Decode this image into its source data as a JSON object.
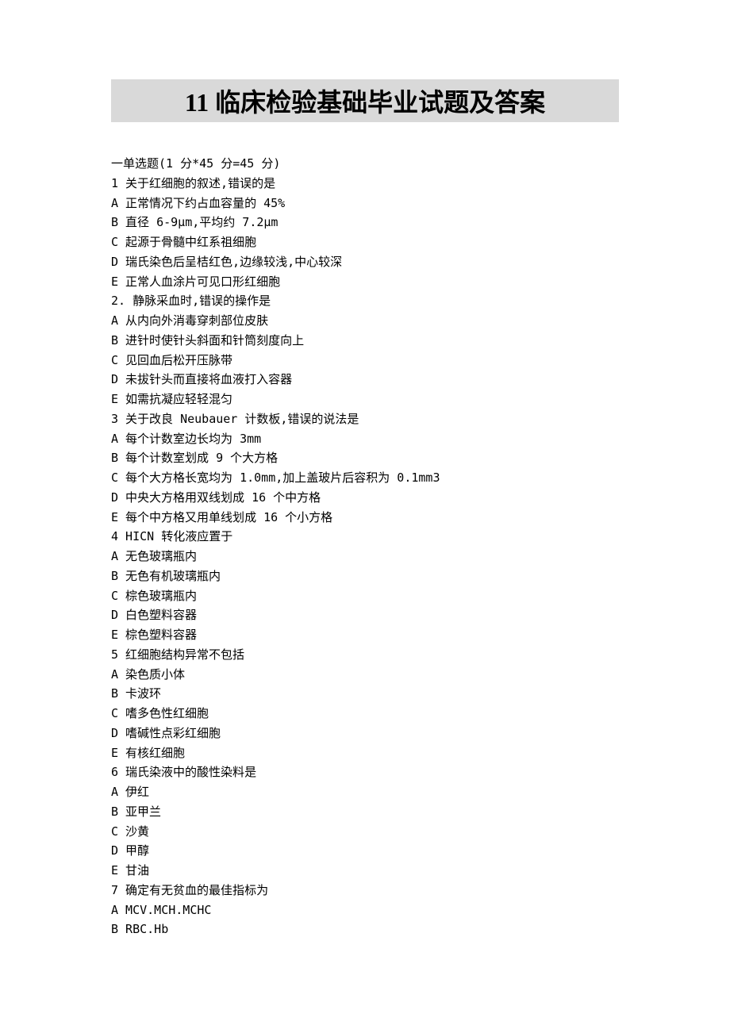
{
  "title": "11 临床检验基础毕业试题及答案",
  "section_header": "一单选题(1 分*45 分=45 分)",
  "questions": [
    {
      "stem": "1 关于红细胞的叙述,错误的是",
      "options": [
        "A 正常情况下约占血容量的 45%",
        "B 直径 6-9μm,平均约 7.2μm",
        "C 起源于骨髓中红系祖细胞",
        "D 瑞氏染色后呈桔红色,边缘较浅,中心较深",
        "E 正常人血涂片可见口形红细胞"
      ]
    },
    {
      "stem": "2. 静脉采血时,错误的操作是",
      "options": [
        "A 从内向外消毒穿刺部位皮肤",
        "B 进针时使针头斜面和针筒刻度向上",
        "C 见回血后松开压脉带",
        "D 未拔针头而直接将血液打入容器",
        "E 如需抗凝应轻轻混匀"
      ]
    },
    {
      "stem": "3 关于改良 Neubauer 计数板,错误的说法是",
      "options": [
        "A 每个计数室边长均为 3mm",
        "B 每个计数室划成 9 个大方格",
        "C 每个大方格长宽均为 1.0mm,加上盖玻片后容积为 0.1mm3",
        "D 中央大方格用双线划成 16 个中方格",
        "E 每个中方格又用单线划成 16 个小方格"
      ]
    },
    {
      "stem": "4 HICN 转化液应置于",
      "options": [
        "A 无色玻璃瓶内",
        "B 无色有机玻璃瓶内",
        "C 棕色玻璃瓶内",
        "D 白色塑料容器",
        "E 棕色塑料容器"
      ]
    },
    {
      "stem": "5 红细胞结构异常不包括",
      "options": [
        "A 染色质小体",
        "B 卡波环",
        "C 嗜多色性红细胞",
        "D 嗜碱性点彩红细胞",
        "E 有核红细胞"
      ]
    },
    {
      "stem": "6 瑞氏染液中的酸性染料是",
      "options": [
        "A 伊红",
        "B 亚甲兰",
        "C 沙黄",
        "D 甲醇",
        "E 甘油"
      ]
    },
    {
      "stem": "7 确定有无贫血的最佳指标为",
      "options": [
        "A MCV.MCH.MCHC",
        "B RBC.Hb"
      ]
    }
  ]
}
